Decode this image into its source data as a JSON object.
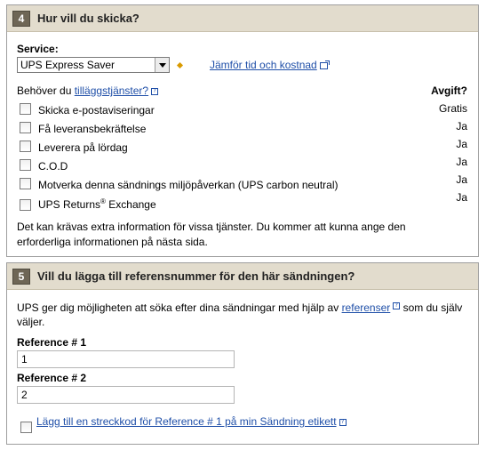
{
  "section4": {
    "number": "4",
    "title": "Hur vill du skicka?",
    "service_label": "Service:",
    "service_value": "UPS Express Saver",
    "compare_link": "Jämför tid och kostnad",
    "extras_prefix": "Behöver du ",
    "extras_link": "tilläggstjänster?",
    "fee_header": "Avgift?",
    "options": [
      {
        "label": "Skicka e-postaviseringar",
        "fee": "Gratis",
        "checked": false
      },
      {
        "label": "Få leveransbekräftelse",
        "fee": "Ja",
        "checked": false
      },
      {
        "label": "Leverera på lördag",
        "fee": "Ja",
        "checked": false
      },
      {
        "label": "C.O.D",
        "fee": "Ja",
        "checked": false
      },
      {
        "label": "Motverka denna sändnings miljöpåverkan (UPS carbon neutral)",
        "fee": "Ja",
        "checked": false
      },
      {
        "label_main": "UPS Returns",
        "label_sup": "®",
        "label_tail": " Exchange",
        "fee": "Ja",
        "checked": false
      }
    ],
    "note": "Det kan krävas extra information för vissa tjänster. Du kommer att kunna ange den erforderliga informationen på nästa sida."
  },
  "section5": {
    "number": "5",
    "title": "Vill du lägga till referensnummer för den här sändningen?",
    "intro_prefix": "UPS ger dig möjligheten att söka efter dina sändningar med hjälp av ",
    "intro_link": "referenser",
    "intro_suffix": " som du själv väljer.",
    "ref1_label": "Reference # 1",
    "ref1_value": "1",
    "ref2_label": "Reference # 2",
    "ref2_value": "2",
    "barcode_link": "Lägg till en streckkod för Reference # 1 på min Sändning etikett",
    "barcode_checked": false
  },
  "colors": {
    "header_bg": "#e2dccd",
    "step_badge_bg": "#6e6656",
    "link": "#1f4fa8",
    "diamond": "#d99a00"
  },
  "icons": [
    "help-icon",
    "popup-window-icon",
    "dropdown-arrow-icon",
    "required-diamond-icon"
  ]
}
